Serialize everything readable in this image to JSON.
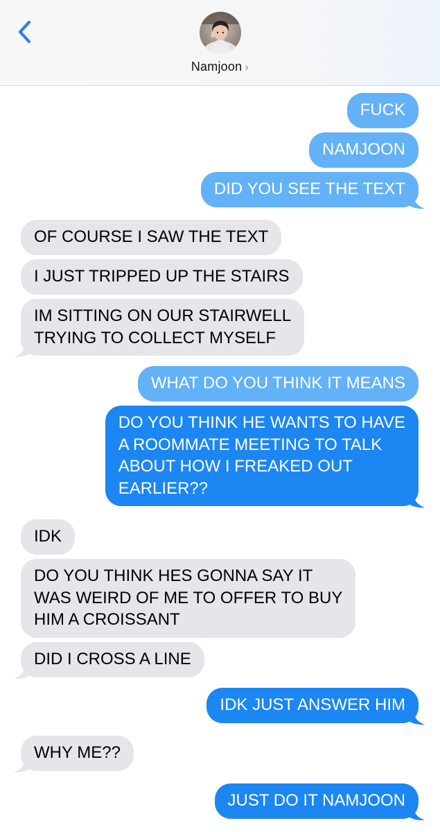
{
  "header": {
    "contact_name": "Namjoon",
    "chevron": "›",
    "back_icon": "chevron-left-icon",
    "accent": "#2d7cf6"
  },
  "colors": {
    "outgoing_light": "#63b1f7",
    "outgoing_dark": "#1c86f2",
    "incoming": "#e5e5ea"
  },
  "messages": [
    {
      "side": "out",
      "text": "FUCK"
    },
    {
      "side": "out",
      "text": "NAMJOON"
    },
    {
      "side": "out",
      "text": "DID YOU SEE THE TEXT"
    },
    {
      "side": "in",
      "text": "OF COURSE I SAW THE TEXT"
    },
    {
      "side": "in",
      "text": "I JUST TRIPPED UP THE STAIRS"
    },
    {
      "side": "in",
      "text": "IM SITTING ON OUR STAIRWELL\nTRYING TO COLLECT MYSELF"
    },
    {
      "side": "out",
      "text": "WHAT DO YOU THINK IT MEANS"
    },
    {
      "side": "out",
      "text": "DO YOU THINK HE WANTS TO HAVE\nA ROOMMATE MEETING TO TALK\nABOUT HOW I FREAKED OUT\nEARLIER??"
    },
    {
      "side": "in",
      "text": "IDK"
    },
    {
      "side": "in",
      "text": "DO YOU THINK HES GONNA SAY IT\nWAS WEIRD OF ME TO OFFER TO BUY\nHIM A CROISSANT"
    },
    {
      "side": "in",
      "text": "DID I CROSS A LINE"
    },
    {
      "side": "out",
      "text": "IDK JUST ANSWER HIM"
    },
    {
      "side": "in",
      "text": "WHY ME??"
    },
    {
      "side": "out",
      "text": "JUST DO IT NAMJOON"
    }
  ]
}
